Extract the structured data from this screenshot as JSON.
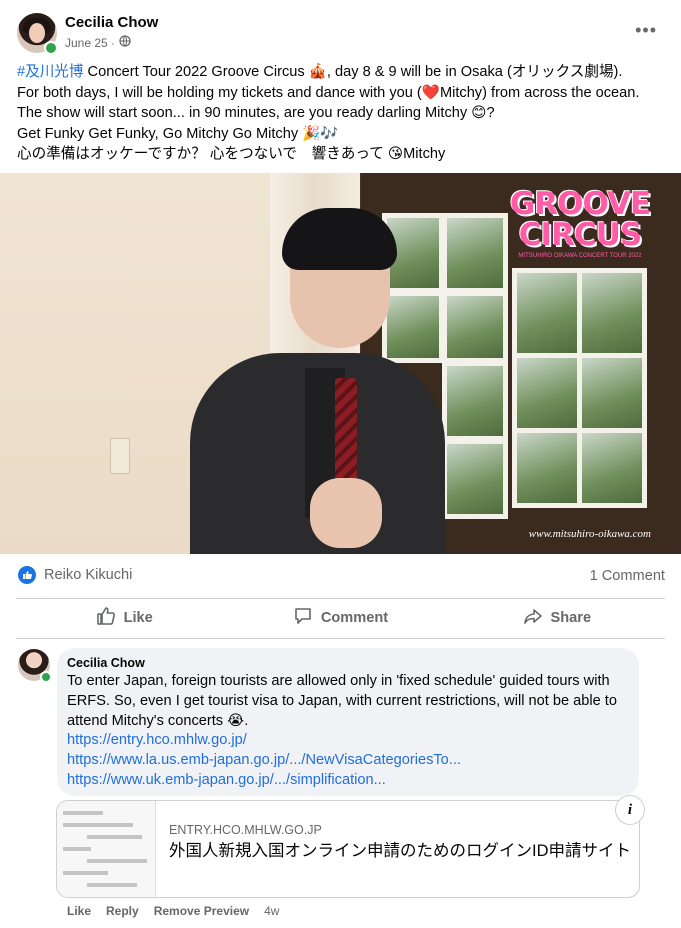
{
  "post": {
    "author": "Cecilia Chow",
    "date": "June 25 ·",
    "privacy_icon": "globe-icon",
    "lines": [
      {
        "hashtag": "#及川光博",
        "rest": " Concert Tour 2022 Groove Circus 🎪, day 8 & 9 will be in Osaka (オリックス劇場)."
      },
      {
        "text": "For both days, I will be holding my tickets and dance with you (❤️Mitchy) from across the ocean."
      },
      {
        "text": "The show will start soon... in 90 minutes, are you ready darling Mitchy 😊?"
      },
      {
        "text": "Get Funky Get Funky, Go Mitchy Go Mitchy 🎉🎶"
      },
      {
        "text": "心の準備はオッケーですか？ 心をつないで　響きあって 😘Mitchy"
      }
    ],
    "image": {
      "logo_line1": "GROOVE",
      "logo_line2": "CIRCUS",
      "logo_small": "MITSUHIRO OIKAWA CONCERT TOUR 2022",
      "watermark": "www.mitsuhiro-oikawa.com"
    }
  },
  "reactions": {
    "names": "Reiko Kikuchi",
    "comment_count": "1 Comment"
  },
  "actions": {
    "like": "Like",
    "comment": "Comment",
    "share": "Share"
  },
  "comment": {
    "author": "Cecilia Chow",
    "text_lines": [
      "To enter Japan, foreign tourists are allowed only in 'fixed schedule' guided tours with",
      "ERFS. So, even I get tourist visa to Japan, with current restrictions, will not be able to",
      "attend Mitchy's concerts 😭."
    ],
    "links": [
      "https://entry.hco.mhlw.go.jp/",
      "https://www.la.us.emb-japan.go.jp/.../NewVisaCategoriesTo...",
      "https://www.uk.emb-japan.go.jp/.../simplification..."
    ],
    "preview": {
      "domain": "ENTRY.HCO.MHLW.GO.JP",
      "title": "外国人新規入国オンライン申請のためのログインID申請サイト",
      "info_label": "i"
    },
    "actions": {
      "like": "Like",
      "reply": "Reply",
      "remove_preview": "Remove Preview",
      "time": "4w"
    }
  },
  "colors": {
    "link": "#216fdb",
    "muted": "#65676b",
    "like_blue": "#1b74e4",
    "online_green": "#31a24c",
    "logo_pink": "#ff5ca8"
  }
}
